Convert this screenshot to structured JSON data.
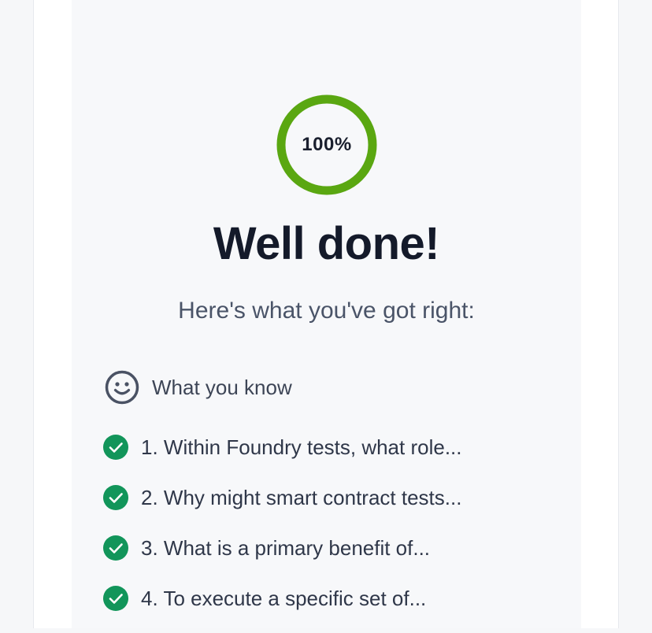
{
  "result": {
    "progress_text": "100%",
    "progress_fraction": 1.0,
    "ring_color": "#5aa711",
    "headline": "Well done!",
    "subhead": "Here's what you've got right:"
  },
  "section": {
    "icon": "smile-icon",
    "label": "What you know"
  },
  "answers": [
    {
      "text": "1. Within Foundry tests, what role...",
      "status": "correct",
      "icon": "check-circle-icon"
    },
    {
      "text": "2. Why might smart contract tests...",
      "status": "correct",
      "icon": "check-circle-icon"
    },
    {
      "text": "3. What is a primary benefit of...",
      "status": "correct",
      "icon": "check-circle-icon"
    },
    {
      "text": "4. To execute a specific set of...",
      "status": "correct",
      "icon": "check-circle-icon"
    }
  ],
  "colors": {
    "check_green": "#12955a",
    "text_dark": "#141a2a",
    "text_muted": "#4a5468"
  }
}
